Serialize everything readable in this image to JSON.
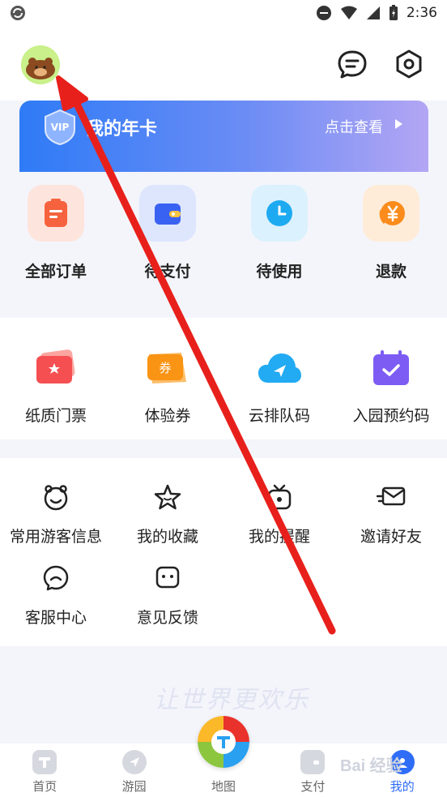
{
  "status_bar": {
    "time": "2:36"
  },
  "vip_card": {
    "title": "我的年卡",
    "action": "点击查看",
    "badge_text": "VIP"
  },
  "orders": [
    {
      "label": "全部订单",
      "icon": "order-list-icon",
      "color": "#f5623d"
    },
    {
      "label": "待支付",
      "icon": "wallet-icon",
      "color": "#3a62f2"
    },
    {
      "label": "待使用",
      "icon": "clock-icon",
      "color": "#1eaaf1"
    },
    {
      "label": "退款",
      "icon": "yuan-coin-icon",
      "color": "#fb8c1c"
    }
  ],
  "tickets": [
    {
      "label": "纸质门票",
      "icon": "paper-ticket-icon"
    },
    {
      "label": "体验券",
      "icon": "voucher-icon",
      "voucher_text": "券"
    },
    {
      "label": "云排队码",
      "icon": "cloud-queue-icon"
    },
    {
      "label": "入园预约码",
      "icon": "calendar-check-icon"
    }
  ],
  "services_row1": [
    {
      "label": "常用游客信息",
      "icon": "visitor-info-icon"
    },
    {
      "label": "我的收藏",
      "icon": "star-icon"
    },
    {
      "label": "我的提醒",
      "icon": "tv-reminder-icon"
    },
    {
      "label": "邀请好友",
      "icon": "invite-mail-icon"
    }
  ],
  "services_row2": [
    {
      "label": "客服中心",
      "icon": "chat-support-icon"
    },
    {
      "label": "意见反馈",
      "icon": "feedback-icon"
    }
  ],
  "slogan": "让世界更欢乐",
  "tabs": [
    {
      "label": "首页",
      "icon": "home-icon",
      "active": false
    },
    {
      "label": "游园",
      "icon": "navigate-icon",
      "active": false
    },
    {
      "label": "地图",
      "icon": "map-pin-icon",
      "active": false
    },
    {
      "label": "支付",
      "icon": "wallet-icon",
      "active": false
    },
    {
      "label": "我的",
      "icon": "profile-icon",
      "active": true
    }
  ],
  "watermark": "Bai 经验",
  "colors": {
    "accent": "#2f6df6",
    "annotation_arrow": "#e8201c",
    "vip_gradient_start": "#2e7bf6",
    "vip_gradient_end": "#b3a6f4"
  }
}
